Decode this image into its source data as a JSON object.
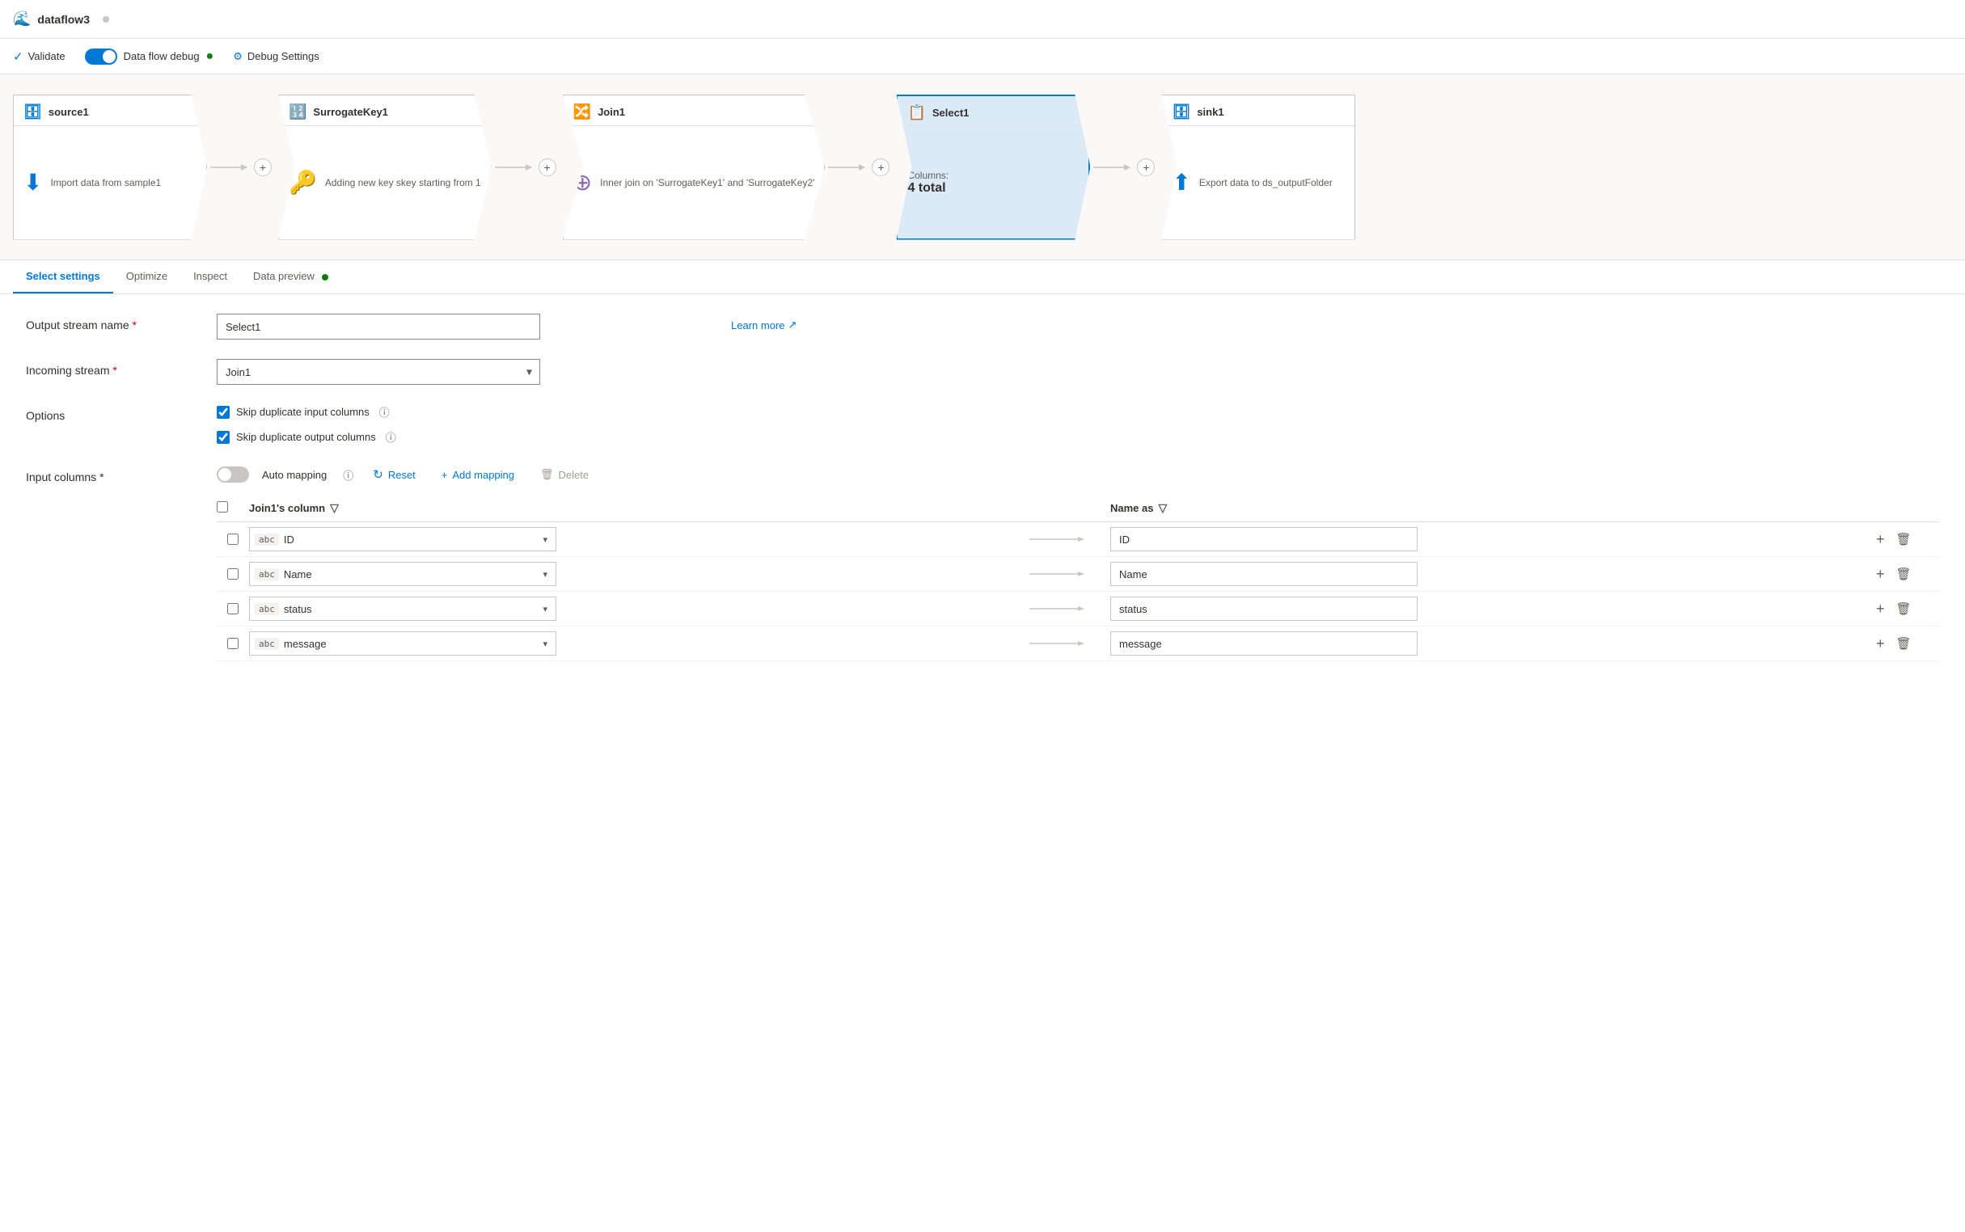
{
  "app": {
    "title": "dataflow3",
    "dot_color": "#c8c6c4"
  },
  "toolbar": {
    "validate_label": "Validate",
    "debug_label": "Data flow debug",
    "debug_settings_label": "Debug Settings"
  },
  "pipeline": {
    "nodes": [
      {
        "id": "source1",
        "label": "source1",
        "description": "Import data from sample1",
        "type": "source",
        "icon": "📥",
        "active": false
      },
      {
        "id": "surrogatekey1",
        "label": "SurrogateKey1",
        "description": "Adding new key skey starting from 1",
        "type": "transform",
        "icon": "🔑",
        "active": false
      },
      {
        "id": "join1",
        "label": "Join1",
        "description": "Inner join on 'SurrogateKey1' and 'SurrogateKey2'",
        "type": "join",
        "icon": "🔗",
        "active": false
      },
      {
        "id": "select1",
        "label": "Select1",
        "description": "Columns:",
        "columns_count": "4 total",
        "type": "select",
        "icon": "✅",
        "active": true
      },
      {
        "id": "sink1",
        "label": "sink1",
        "description": "Export data to ds_outputFolder",
        "type": "sink",
        "icon": "📤",
        "active": false
      }
    ]
  },
  "tabs": [
    {
      "id": "select-settings",
      "label": "Select settings",
      "active": true
    },
    {
      "id": "optimize",
      "label": "Optimize",
      "active": false
    },
    {
      "id": "inspect",
      "label": "Inspect",
      "active": false
    },
    {
      "id": "data-preview",
      "label": "Data preview",
      "active": false,
      "dot": true
    }
  ],
  "form": {
    "output_stream_name_label": "Output stream name",
    "output_stream_name_value": "Select1",
    "incoming_stream_label": "Incoming stream",
    "incoming_stream_value": "Join1",
    "learn_more_label": "Learn more",
    "options_label": "Options",
    "skip_duplicate_input_label": "Skip duplicate input columns",
    "skip_duplicate_output_label": "Skip duplicate output columns",
    "input_columns_label": "Input columns",
    "auto_mapping_label": "Auto mapping",
    "reset_label": "Reset",
    "add_mapping_label": "Add mapping",
    "delete_label": "Delete"
  },
  "mapping_table": {
    "source_col_header": "Join1's column",
    "target_col_header": "Name as",
    "rows": [
      {
        "id": 1,
        "source": "ID",
        "target": "ID"
      },
      {
        "id": 2,
        "source": "Name",
        "target": "Name"
      },
      {
        "id": 3,
        "source": "status",
        "target": "status"
      },
      {
        "id": 4,
        "source": "message",
        "target": "message"
      }
    ]
  }
}
